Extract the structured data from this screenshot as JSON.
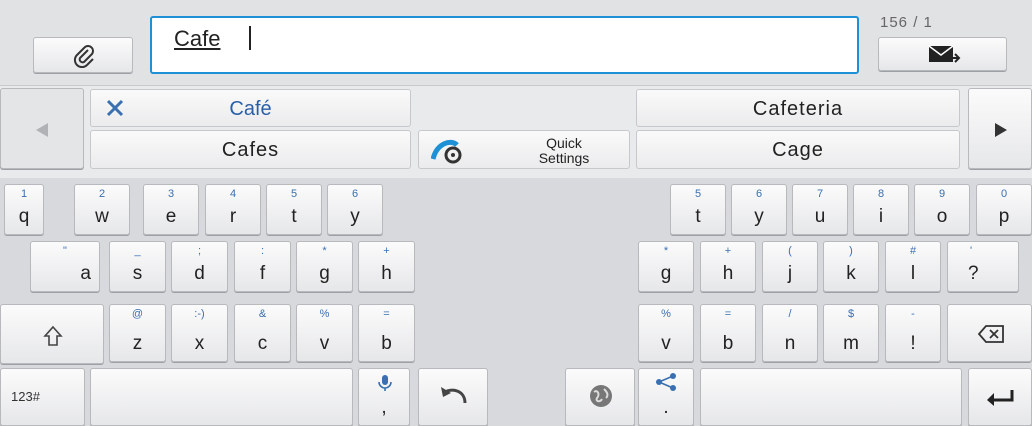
{
  "compose": {
    "text": "Cafe",
    "counter": "156 / 1"
  },
  "suggestions": {
    "row1": [
      "Café",
      "Cafeteria"
    ],
    "row2": [
      "Cafes",
      "Cage"
    ],
    "quick_settings": [
      "Quick",
      "Settings"
    ]
  },
  "left_keys": {
    "row1": [
      {
        "hint": "1",
        "key": "q"
      },
      {
        "hint": "2",
        "key": "w"
      },
      {
        "hint": "3",
        "key": "e"
      },
      {
        "hint": "4",
        "key": "r"
      },
      {
        "hint": "5",
        "key": "t"
      },
      {
        "hint": "6",
        "key": "y"
      }
    ],
    "row2": [
      {
        "hint": "\"",
        "key": "a"
      },
      {
        "hint": "_",
        "key": "s"
      },
      {
        "hint": ";",
        "key": "d"
      },
      {
        "hint": ":",
        "key": "f"
      },
      {
        "hint": "*",
        "key": "g"
      },
      {
        "hint": "+",
        "key": "h"
      }
    ],
    "row3": [
      {
        "hint": "@",
        "key": "z"
      },
      {
        "hint": ":-)",
        "key": "x"
      },
      {
        "hint": "&",
        "key": "c"
      },
      {
        "hint": "%",
        "key": "v"
      },
      {
        "hint": "=",
        "key": "b"
      }
    ]
  },
  "right_keys": {
    "row1": [
      {
        "hint": "5",
        "key": "t"
      },
      {
        "hint": "6",
        "key": "y"
      },
      {
        "hint": "7",
        "key": "u"
      },
      {
        "hint": "8",
        "key": "i"
      },
      {
        "hint": "9",
        "key": "o"
      },
      {
        "hint": "0",
        "key": "p"
      }
    ],
    "row2": [
      {
        "hint": "*",
        "key": "g"
      },
      {
        "hint": "+",
        "key": "h"
      },
      {
        "hint": "(",
        "key": "j"
      },
      {
        "hint": ")",
        "key": "k"
      },
      {
        "hint": "#",
        "key": "l"
      },
      {
        "hint": "'",
        "key": "?"
      }
    ],
    "row3": [
      {
        "hint": "%",
        "key": "v"
      },
      {
        "hint": "=",
        "key": "b"
      },
      {
        "hint": "/",
        "key": "n"
      },
      {
        "hint": "$",
        "key": "m"
      },
      {
        "hint": "-",
        "key": "!"
      }
    ]
  },
  "bottom": {
    "mode_label": "123#",
    "comma": ",",
    "period": "."
  },
  "colors": {
    "accent": "#1e90d6",
    "hint": "#3a6fb0",
    "background": "#e9eaec"
  },
  "icons": [
    "paperclip-icon",
    "send-icon",
    "close-icon",
    "left-arrow-icon",
    "right-arrow-icon",
    "quick-settings-icon",
    "shift-icon",
    "backspace-icon",
    "mic-icon",
    "undo-icon",
    "globe-icon",
    "share-icon",
    "enter-icon"
  ]
}
